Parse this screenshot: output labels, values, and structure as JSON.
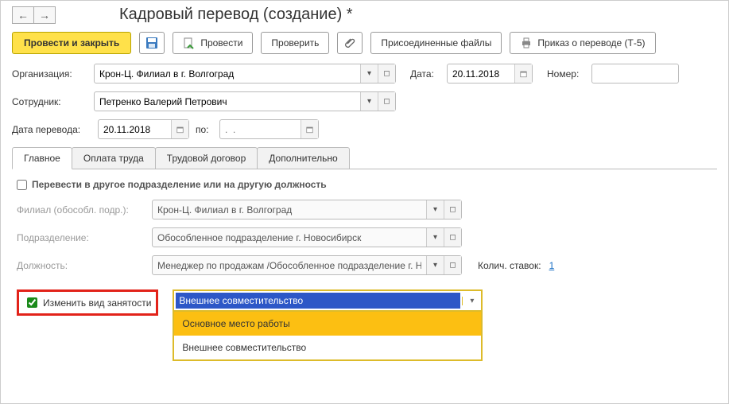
{
  "nav": {
    "back": "←",
    "forward": "→"
  },
  "title": "Кадровый перевод (создание) *",
  "toolbar": {
    "post_close": "Провести и закрыть",
    "post": "Провести",
    "check": "Проверить",
    "attached": "Присоединенные файлы",
    "order": "Приказ о переводе (Т-5)"
  },
  "form": {
    "org_label": "Организация:",
    "org_value": "Крон-Ц. Филиал в г. Волгоград",
    "date_label": "Дата:",
    "date_value": "20.11.2018",
    "number_label": "Номер:",
    "number_value": "",
    "emp_label": "Сотрудник:",
    "emp_value": "Петренко Валерий Петрович",
    "transfer_date_label": "Дата перевода:",
    "transfer_date_value": "20.11.2018",
    "to_label": "по:",
    "to_placeholder": ".  .",
    "to_value": ""
  },
  "tabs": {
    "main": "Главное",
    "payment": "Оплата труда",
    "contract": "Трудовой договор",
    "extra": "Дополнительно"
  },
  "main_tab": {
    "cb_transfer_label": "Перевести в другое подразделение или на другую должность",
    "branch_label": "Филиал (обособл. подр.):",
    "branch_value": "Крон-Ц. Филиал в г. Волгоград",
    "dept_label": "Подразделение:",
    "dept_value": "Обособленное подразделение г. Новосибирск",
    "position_label": "Должность:",
    "position_value": "Менеджер по продажам /Обособленное подразделение г. Н",
    "rates_label": "Колич. ставок:",
    "rates_value": "1",
    "cb_change_label": "Изменить вид занятости",
    "occupation_selected": "Внешнее совместительство",
    "occupation_options": [
      "Основное место работы",
      "Внешнее совместительство"
    ]
  }
}
